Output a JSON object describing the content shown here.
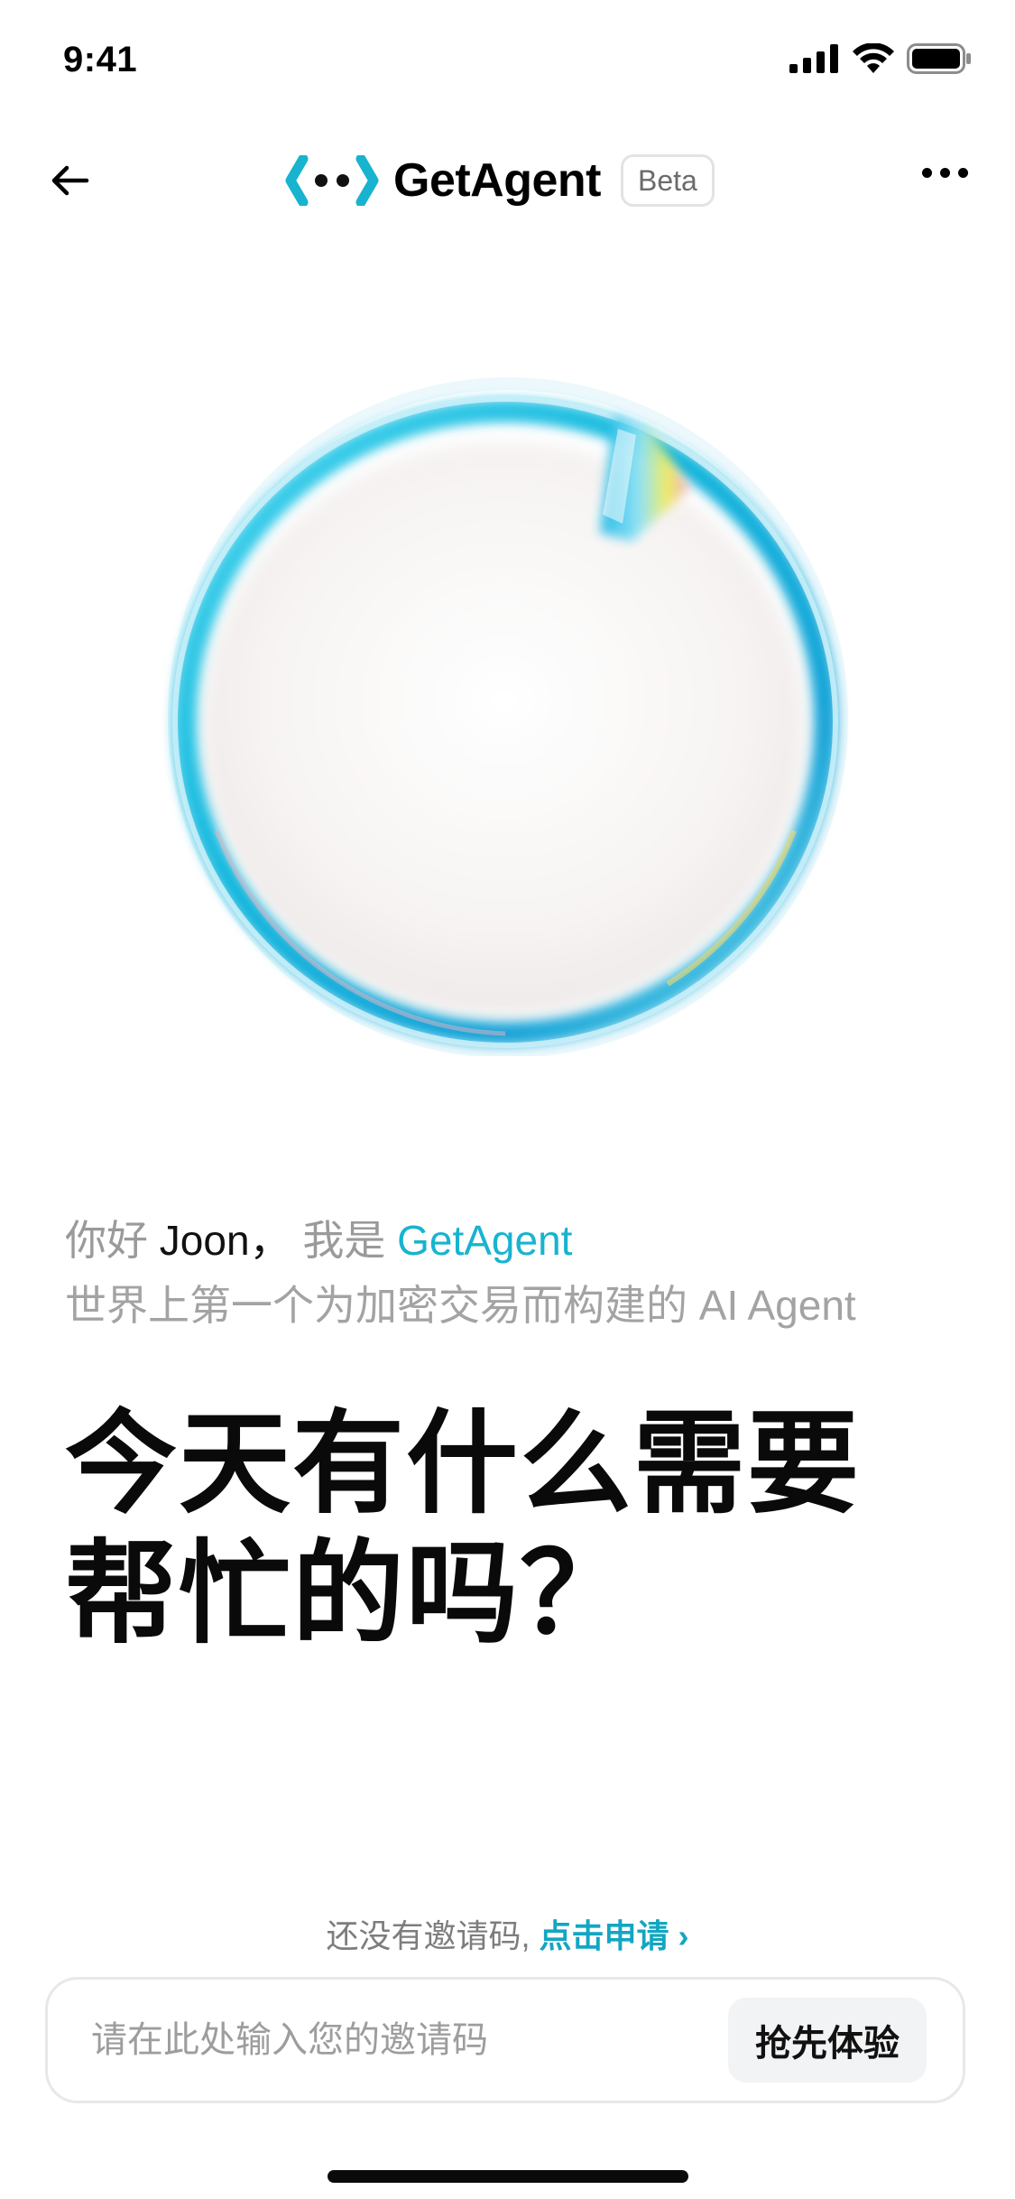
{
  "status_bar": {
    "time": "9:41"
  },
  "nav": {
    "brand_name": "GetAgent",
    "badge": "Beta"
  },
  "greeting": {
    "hello": "你好",
    "user_name": "Joon",
    "comma": "，",
    "i_am": "我是",
    "agent_name": "GetAgent",
    "tagline": "世界上第一个为加密交易而构建的 AI Agent"
  },
  "headline": "今天有什么需要帮忙的吗？",
  "invite": {
    "prompt": "还没有邀请码,",
    "apply_link": "点击申请",
    "chevron": "›",
    "input_placeholder": "请在此处输入您的邀请码",
    "input_value": "",
    "submit_label": "抢先体验"
  },
  "colors": {
    "accent": "#18b3cf",
    "background": "#ffffff",
    "button_bg": "#f2f3f5"
  },
  "icons": [
    "cellular-signal-icon",
    "wifi-icon",
    "battery-icon",
    "back-arrow-icon",
    "getagent-logo-icon",
    "more-icon",
    "chevron-right-icon"
  ]
}
